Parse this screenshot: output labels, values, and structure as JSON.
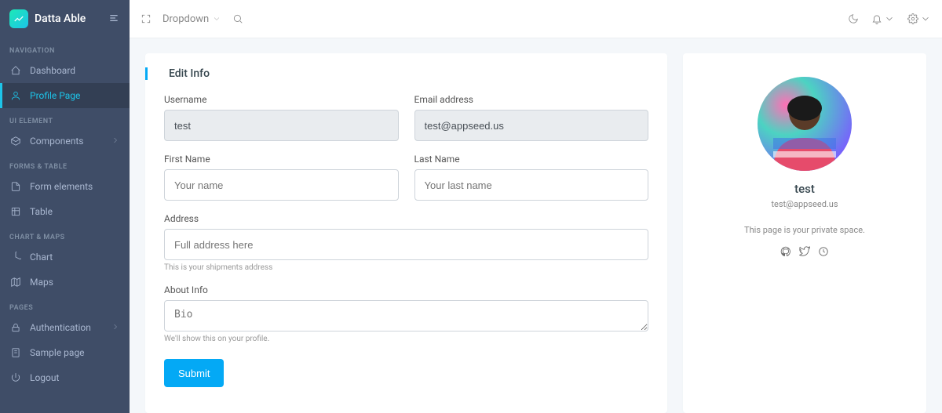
{
  "brand": {
    "name": "Datta Able"
  },
  "sidebar": {
    "sections": [
      {
        "label": "NAVIGATION",
        "items": [
          {
            "icon": "home",
            "label": "Dashboard"
          },
          {
            "icon": "user",
            "label": "Profile Page",
            "active": true
          }
        ]
      },
      {
        "label": "UI ELEMENT",
        "items": [
          {
            "icon": "box",
            "label": "Components",
            "chevron": true
          }
        ]
      },
      {
        "label": "FORMS & TABLE",
        "items": [
          {
            "icon": "file",
            "label": "Form elements"
          },
          {
            "icon": "table",
            "label": "Table"
          }
        ]
      },
      {
        "label": "CHART & MAPS",
        "items": [
          {
            "icon": "pie",
            "label": "Chart"
          },
          {
            "icon": "map",
            "label": "Maps"
          }
        ]
      },
      {
        "label": "PAGES",
        "items": [
          {
            "icon": "lock",
            "label": "Authentication",
            "chevron": true
          },
          {
            "icon": "page",
            "label": "Sample page"
          },
          {
            "icon": "power",
            "label": "Logout"
          }
        ]
      }
    ]
  },
  "header": {
    "dropdown_label": "Dropdown"
  },
  "form": {
    "title": "Edit Info",
    "username_label": "Username",
    "username_value": "test",
    "email_label": "Email address",
    "email_value": "test@appseed.us",
    "first_label": "First Name",
    "first_placeholder": "Your name",
    "last_label": "Last Name",
    "last_placeholder": "Your last name",
    "address_label": "Address",
    "address_placeholder": "Full address here",
    "address_hint": "This is your shipments address",
    "about_label": "About Info",
    "about_placeholder": "Bio",
    "about_hint": "We'll show this on your profile.",
    "submit_label": "Submit"
  },
  "profile": {
    "name": "test",
    "email": "test@appseed.us",
    "note": "This page is your private space."
  }
}
